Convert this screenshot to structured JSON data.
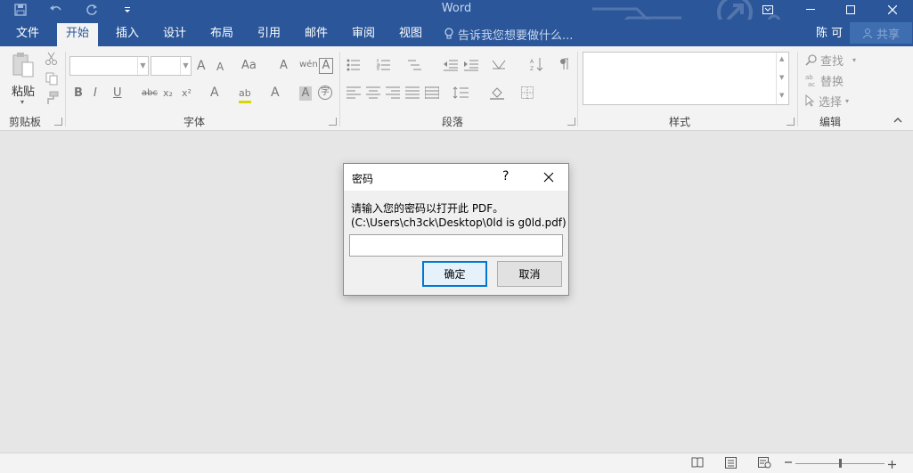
{
  "app": {
    "title": "Word"
  },
  "window": {
    "minimize": "—",
    "maximize": "☐",
    "close": "✕"
  },
  "tabs": [
    {
      "label": "文件"
    },
    {
      "label": "开始"
    },
    {
      "label": "插入"
    },
    {
      "label": "设计"
    },
    {
      "label": "布局"
    },
    {
      "label": "引用"
    },
    {
      "label": "邮件"
    },
    {
      "label": "审阅"
    },
    {
      "label": "视图"
    }
  ],
  "tell_me": {
    "placeholder": "告诉我您想要做什么..."
  },
  "user": {
    "name": "陈 可",
    "share_label": "共享"
  },
  "ribbon": {
    "clipboard": {
      "label": "剪贴板",
      "paste_label": "粘贴"
    },
    "font": {
      "label": "字体",
      "bold": "B",
      "italic": "I",
      "underline": "U",
      "strike": "abc",
      "subscript": "x₂",
      "superscript": "x²",
      "grow": "A",
      "shrink": "A",
      "case": "Aa",
      "clear": "A",
      "phonetic": "wén",
      "border_char": "A",
      "effects": "A",
      "highlight": "ab",
      "color": "A",
      "shading": "A",
      "enclose": "字"
    },
    "paragraph": {
      "label": "段落"
    },
    "styles": {
      "label": "样式"
    },
    "editing": {
      "label": "编辑",
      "find": "查找",
      "replace": "替换",
      "select": "选择"
    }
  },
  "dialog": {
    "title": "密码",
    "help": "?",
    "message_line1": "请输入您的密码以打开此 PDF。",
    "message_line2": "(C:\\Users\\ch3ck\\Desktop\\0ld is g0ld.pdf)",
    "password_value": "",
    "ok_label": "确定",
    "cancel_label": "取消"
  },
  "colors": {
    "accent": "#2b579a",
    "focus": "#0078d7"
  }
}
